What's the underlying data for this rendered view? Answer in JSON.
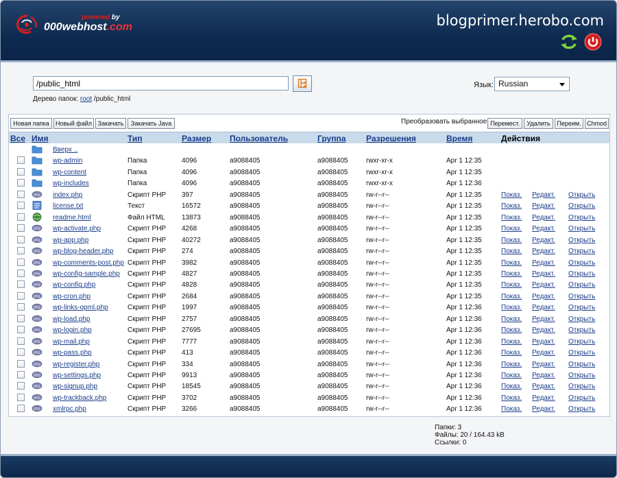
{
  "brand": {
    "powered": "powered",
    "by": "by",
    "name": "000webhost",
    "tld": ".com"
  },
  "site_title": "blogprimer.herobo.com",
  "path": {
    "value": "/public_html"
  },
  "tree": {
    "label": "Дерево папок:",
    "root": "root",
    "current": "/public_html"
  },
  "language": {
    "label": "Язык:",
    "value": "Russian"
  },
  "toolbar": {
    "new_folder": "Новая папка",
    "new_file": "Новый файл",
    "upload": "Закачать",
    "upload_java": "Закачать Java",
    "convert_label": "Преобразовать выбранное:",
    "move": "Перемест.",
    "delete": "Удалить",
    "rename": "Переим.",
    "chmod": "Chmod"
  },
  "columns": {
    "all": "Все",
    "name": "Имя",
    "type": "Тип",
    "size": "Размер",
    "user": "Пользователь",
    "group": "Группа",
    "perms": "Разрешения",
    "time": "Время",
    "actions": "Действия"
  },
  "up_label": "Вверх ..",
  "actions": {
    "show": "Показ.",
    "edit": "Редакт.",
    "open": "Открыть"
  },
  "files": [
    {
      "name": "wp-admin",
      "type": "Папка",
      "size": "4096",
      "user": "a9088405",
      "group": "a9088405",
      "perms": "rwxr-xr-x",
      "time": "Apr 1 12:35",
      "icon": "folder"
    },
    {
      "name": "wp-content",
      "type": "Папка",
      "size": "4096",
      "user": "a9088405",
      "group": "a9088405",
      "perms": "rwxr-xr-x",
      "time": "Apr 1 12:35",
      "icon": "folder"
    },
    {
      "name": "wp-includes",
      "type": "Папка",
      "size": "4096",
      "user": "a9088405",
      "group": "a9088405",
      "perms": "rwxr-xr-x",
      "time": "Apr 1 12:36",
      "icon": "folder"
    },
    {
      "name": "index.php",
      "type": "Скрипт PHP",
      "size": "397",
      "user": "a9088405",
      "group": "a9088405",
      "perms": "rw-r--r--",
      "time": "Apr 1 12:35",
      "icon": "php"
    },
    {
      "name": "license.txt",
      "type": "Текст",
      "size": "16572",
      "user": "a9088405",
      "group": "a9088405",
      "perms": "rw-r--r--",
      "time": "Apr 1 12:35",
      "icon": "text"
    },
    {
      "name": "readme.html",
      "type": "Файл HTML",
      "size": "13873",
      "user": "a9088405",
      "group": "a9088405",
      "perms": "rw-r--r--",
      "time": "Apr 1 12:35",
      "icon": "html"
    },
    {
      "name": "wp-activate.php",
      "type": "Скрипт PHP",
      "size": "4268",
      "user": "a9088405",
      "group": "a9088405",
      "perms": "rw-r--r--",
      "time": "Apr 1 12:35",
      "icon": "php"
    },
    {
      "name": "wp-app.php",
      "type": "Скрипт PHP",
      "size": "40272",
      "user": "a9088405",
      "group": "a9088405",
      "perms": "rw-r--r--",
      "time": "Apr 1 12:35",
      "icon": "php"
    },
    {
      "name": "wp-blog-header.php",
      "type": "Скрипт PHP",
      "size": "274",
      "user": "a9088405",
      "group": "a9088405",
      "perms": "rw-r--r--",
      "time": "Apr 1 12:35",
      "icon": "php"
    },
    {
      "name": "wp-comments-post.php",
      "type": "Скрипт PHP",
      "size": "3982",
      "user": "a9088405",
      "group": "a9088405",
      "perms": "rw-r--r--",
      "time": "Apr 1 12:35",
      "icon": "php"
    },
    {
      "name": "wp-config-sample.php",
      "type": "Скрипт PHP",
      "size": "4827",
      "user": "a9088405",
      "group": "a9088405",
      "perms": "rw-r--r--",
      "time": "Apr 1 12:35",
      "icon": "php"
    },
    {
      "name": "wp-config.php",
      "type": "Скрипт PHP",
      "size": "4828",
      "user": "a9088405",
      "group": "a9088405",
      "perms": "rw-r--r--",
      "time": "Apr 1 12:35",
      "icon": "php"
    },
    {
      "name": "wp-cron.php",
      "type": "Скрипт PHP",
      "size": "2684",
      "user": "a9088405",
      "group": "a9088405",
      "perms": "rw-r--r--",
      "time": "Apr 1 12:35",
      "icon": "php"
    },
    {
      "name": "wp-links-opml.php",
      "type": "Скрипт PHP",
      "size": "1997",
      "user": "a9088405",
      "group": "a9088405",
      "perms": "rw-r--r--",
      "time": "Apr 1 12:36",
      "icon": "php"
    },
    {
      "name": "wp-load.php",
      "type": "Скрипт PHP",
      "size": "2757",
      "user": "a9088405",
      "group": "a9088405",
      "perms": "rw-r--r--",
      "time": "Apr 1 12:36",
      "icon": "php"
    },
    {
      "name": "wp-login.php",
      "type": "Скрипт PHP",
      "size": "27695",
      "user": "a9088405",
      "group": "a9088405",
      "perms": "rw-r--r--",
      "time": "Apr 1 12:36",
      "icon": "php"
    },
    {
      "name": "wp-mail.php",
      "type": "Скрипт PHP",
      "size": "7777",
      "user": "a9088405",
      "group": "a9088405",
      "perms": "rw-r--r--",
      "time": "Apr 1 12:36",
      "icon": "php"
    },
    {
      "name": "wp-pass.php",
      "type": "Скрипт PHP",
      "size": "413",
      "user": "a9088405",
      "group": "a9088405",
      "perms": "rw-r--r--",
      "time": "Apr 1 12:36",
      "icon": "php"
    },
    {
      "name": "wp-register.php",
      "type": "Скрипт PHP",
      "size": "334",
      "user": "a9088405",
      "group": "a9088405",
      "perms": "rw-r--r--",
      "time": "Apr 1 12:36",
      "icon": "php"
    },
    {
      "name": "wp-settings.php",
      "type": "Скрипт PHP",
      "size": "9913",
      "user": "a9088405",
      "group": "a9088405",
      "perms": "rw-r--r--",
      "time": "Apr 1 12:36",
      "icon": "php"
    },
    {
      "name": "wp-signup.php",
      "type": "Скрипт PHP",
      "size": "18545",
      "user": "a9088405",
      "group": "a9088405",
      "perms": "rw-r--r--",
      "time": "Apr 1 12:36",
      "icon": "php"
    },
    {
      "name": "wp-trackback.php",
      "type": "Скрипт PHP",
      "size": "3702",
      "user": "a9088405",
      "group": "a9088405",
      "perms": "rw-r--r--",
      "time": "Apr 1 12:36",
      "icon": "php"
    },
    {
      "name": "xmlrpc.php",
      "type": "Скрипт PHP",
      "size": "3266",
      "user": "a9088405",
      "group": "a9088405",
      "perms": "rw-r--r--",
      "time": "Apr 1 12:36",
      "icon": "php"
    }
  ],
  "stats": {
    "folders": "Папки: 3",
    "files": "Файлы: 20 / 164.43 kB",
    "links": "Ссылки: 0"
  },
  "colors": {
    "header": "#0e2a50",
    "table_head": "#c9dbeb",
    "link": "#1a3c8a",
    "accent_red": "#d42020"
  }
}
